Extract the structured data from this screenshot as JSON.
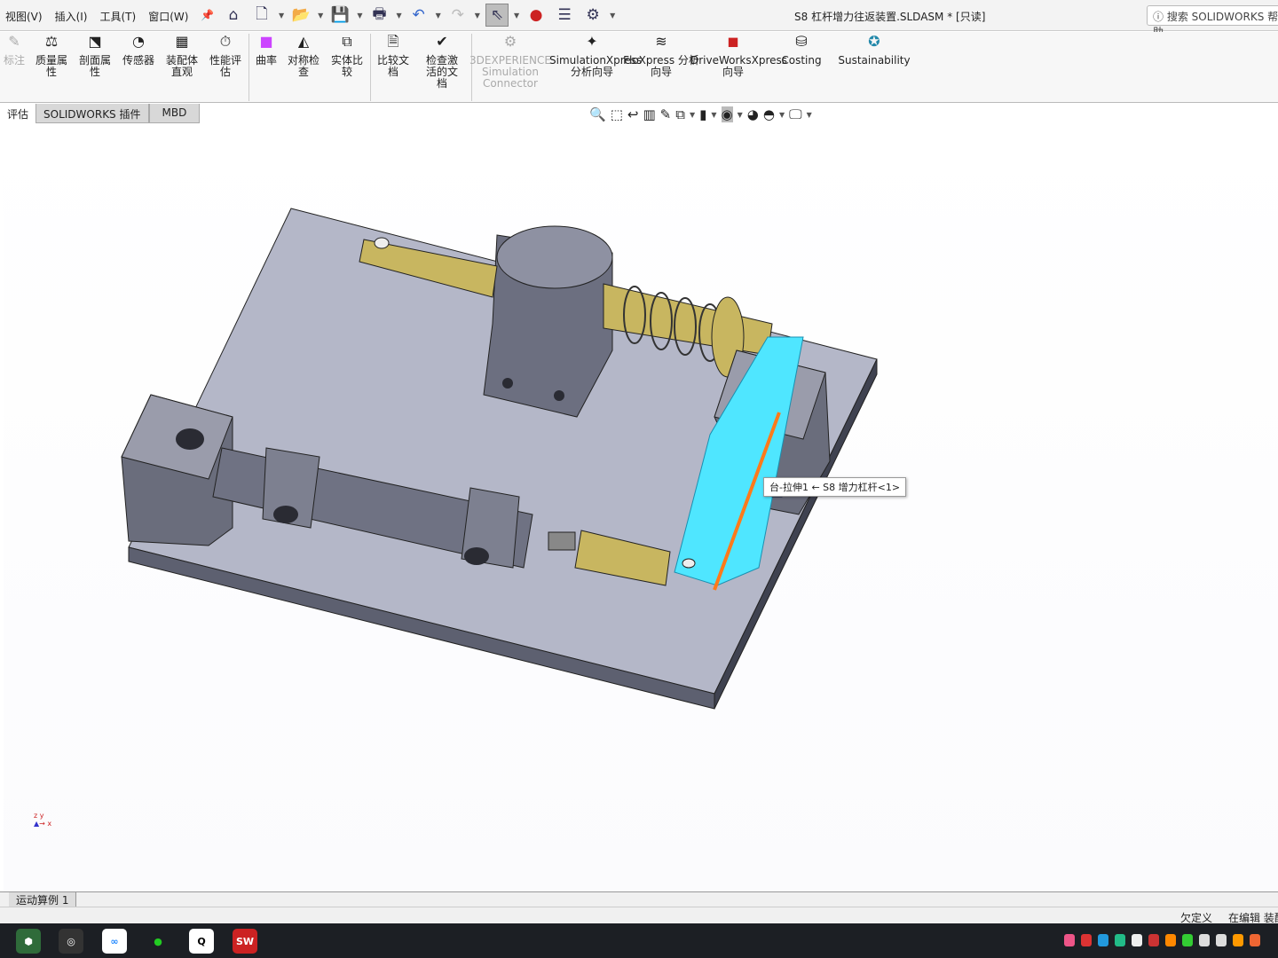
{
  "menu": [
    "视图(V)",
    "插入(I)",
    "工具(T)",
    "窗口(W)"
  ],
  "quick_access_icons": [
    "home-icon",
    "new-document-icon",
    "open-icon",
    "save-icon",
    "print-icon",
    "undo-icon",
    "redo-icon",
    "select-icon",
    "traffic-light-icon",
    "file-properties-icon",
    "options-gear-icon"
  ],
  "document_title": "S8 杠杆增力往返装置.SLDASM * [只读]",
  "search_placeholder": "搜索 SOLIDWORKS 帮助",
  "ribbon": [
    {
      "label": "标注",
      "icon": "markup-icon",
      "disabled": true
    },
    {
      "label": "质量属性",
      "icon": "mass-properties-icon"
    },
    {
      "label": "剖面属性",
      "icon": "section-properties-icon"
    },
    {
      "label": "传感器",
      "icon": "sensor-icon"
    },
    {
      "label": "装配体直观",
      "icon": "assembly-visualization-icon"
    },
    {
      "label": "性能评估",
      "icon": "performance-evaluation-icon"
    },
    {
      "label": "曲率",
      "icon": "curvature-icon"
    },
    {
      "label": "对称检查",
      "icon": "symmetry-check-icon"
    },
    {
      "label": "实体比较",
      "icon": "body-compare-icon"
    },
    {
      "label": "比较文档",
      "icon": "compare-documents-icon"
    },
    {
      "label": "检查激活的文档",
      "icon": "check-document-icon"
    },
    {
      "label": "3DEXPERIENCE Simulation Connector",
      "icon": "simulation-connector-icon",
      "disabled": true
    },
    {
      "label": "SimulationXpress 分析向导",
      "icon": "simulationxpress-icon"
    },
    {
      "label": "FloXpress 分析向导",
      "icon": "floxpress-icon"
    },
    {
      "label": "DriveWorksXpress 向导",
      "icon": "driveworksxpress-icon"
    },
    {
      "label": "Costing",
      "icon": "costing-icon"
    },
    {
      "label": "Sustainability",
      "icon": "sustainability-icon"
    }
  ],
  "tabs": [
    "评估",
    "SOLIDWORKS 插件",
    "MBD"
  ],
  "tooltip": "台-拉伸1 ← S8 增力杠杆<1>",
  "bottom_tab": "运动算例 1",
  "status": {
    "defined": "欠定义",
    "editing": "在编辑 装配体"
  },
  "taskbar_apps": [
    "app-icon",
    "game-icon",
    "baidu-netdisk-icon",
    "wechat-icon",
    "qq-icon",
    "solidworks-2022-icon"
  ],
  "colors": {
    "highlight": "#4fe6ff",
    "edge_highlight": "#ff7a1a",
    "plate": "#b4b7c8",
    "brass": "#c8b660"
  }
}
